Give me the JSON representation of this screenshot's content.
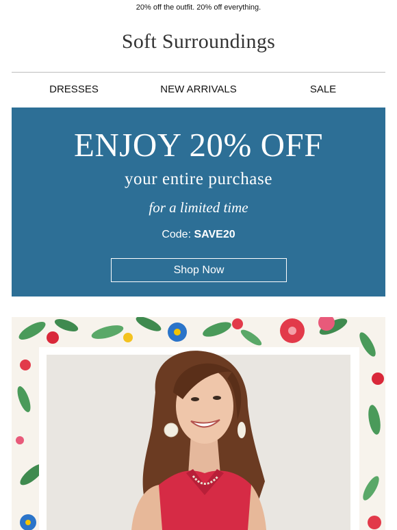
{
  "preheader": "20% off the outfit. 20% off everything.",
  "brand": {
    "logo_text": "Soft Surroundings"
  },
  "nav": {
    "items": [
      {
        "label": "DRESSES"
      },
      {
        "label": "NEW ARRIVALS"
      },
      {
        "label": "SALE"
      }
    ]
  },
  "hero": {
    "title": "ENJOY 20% OFF",
    "subtitle": "your entire purchase",
    "tagline": "for a limited time",
    "code_label": "Code: ",
    "code_value": "SAVE20",
    "cta_label": "Shop Now",
    "bg_color": "#2d6f96"
  },
  "feature_image": {
    "icon": "model-photo-floral-frame",
    "frame_pattern": "floral"
  }
}
